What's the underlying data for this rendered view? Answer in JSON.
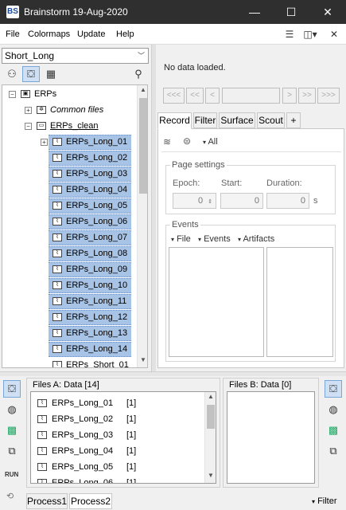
{
  "window": {
    "title": "Brainstorm 19-Aug-2020",
    "app_icon": "BS",
    "minimize": "—",
    "maximize": "☐",
    "close": "✕"
  },
  "menu": {
    "items": [
      "File",
      "Colormaps",
      "Update",
      "Help"
    ]
  },
  "protocol": {
    "selected": "Short_Long"
  },
  "tree": {
    "nodes": [
      {
        "label": "ERPs",
        "depth": 0,
        "expander": "−",
        "icon": "subject-icon"
      },
      {
        "label": "Common files",
        "depth": 1,
        "expander": "+",
        "icon": "common-files-icon"
      },
      {
        "label": "ERPs_clean",
        "depth": 1,
        "expander": "−",
        "icon": "folder-icon"
      },
      {
        "label": "ERPs_Long_01",
        "depth": 2,
        "expander": "+",
        "icon": "data-icon",
        "selected": true
      },
      {
        "label": "ERPs_Long_02",
        "depth": 2,
        "icon": "data-icon",
        "selected": true
      },
      {
        "label": "ERPs_Long_03",
        "depth": 2,
        "icon": "data-icon",
        "selected": true
      },
      {
        "label": "ERPs_Long_04",
        "depth": 2,
        "icon": "data-icon",
        "selected": true
      },
      {
        "label": "ERPs_Long_05",
        "depth": 2,
        "icon": "data-icon",
        "selected": true
      },
      {
        "label": "ERPs_Long_06",
        "depth": 2,
        "icon": "data-icon",
        "selected": true
      },
      {
        "label": "ERPs_Long_07",
        "depth": 2,
        "icon": "data-icon",
        "selected": true
      },
      {
        "label": "ERPs_Long_08",
        "depth": 2,
        "icon": "data-icon",
        "selected": true
      },
      {
        "label": "ERPs_Long_09",
        "depth": 2,
        "icon": "data-icon",
        "selected": true
      },
      {
        "label": "ERPs_Long_10",
        "depth": 2,
        "icon": "data-icon",
        "selected": true
      },
      {
        "label": "ERPs_Long_11",
        "depth": 2,
        "icon": "data-icon",
        "selected": true
      },
      {
        "label": "ERPs_Long_12",
        "depth": 2,
        "icon": "data-icon",
        "selected": true
      },
      {
        "label": "ERPs_Long_13",
        "depth": 2,
        "icon": "data-icon",
        "selected": true
      },
      {
        "label": "ERPs_Long_14",
        "depth": 2,
        "icon": "data-icon",
        "selected": true
      },
      {
        "label": "ERPs_Short_01",
        "depth": 2,
        "icon": "data-icon",
        "selected": false
      }
    ]
  },
  "viewer": {
    "status": "No data loaded.",
    "nav": [
      "<<<",
      "<<",
      "<",
      ">",
      ">>",
      ">>>"
    ]
  },
  "tabs": [
    "Record",
    "Filter",
    "Surface",
    "Scout",
    "+"
  ],
  "record": {
    "filter_all": "All",
    "page_settings": {
      "legend": "Page settings",
      "epoch_label": "Epoch:",
      "epoch_value": "0",
      "start_label": "Start:",
      "start_value": "0",
      "duration_label": "Duration:",
      "duration_value": "0",
      "unit": "s"
    },
    "events": {
      "legend": "Events",
      "menus": [
        "File",
        "Events",
        "Artifacts"
      ]
    }
  },
  "files_a": {
    "title": "Files A: Data [14]",
    "rows": [
      {
        "name": "ERPs_Long_01",
        "count": "[1]"
      },
      {
        "name": "ERPs_Long_02",
        "count": "[1]"
      },
      {
        "name": "ERPs_Long_03",
        "count": "[1]"
      },
      {
        "name": "ERPs_Long_04",
        "count": "[1]"
      },
      {
        "name": "ERPs_Long_05",
        "count": "[1]"
      },
      {
        "name": "ERPs_Long_06",
        "count": "[1]"
      }
    ]
  },
  "files_b": {
    "title": "Files B: Data [0]"
  },
  "left_tools": {
    "run_label": "RUN"
  },
  "bottom_tabs": [
    "Process1",
    "Process2"
  ],
  "filter_button": "Filter",
  "colors": {
    "selection": "#a7c3e6",
    "titlebar": "#2f2f2f",
    "active_tool": "#cfe0f4"
  }
}
